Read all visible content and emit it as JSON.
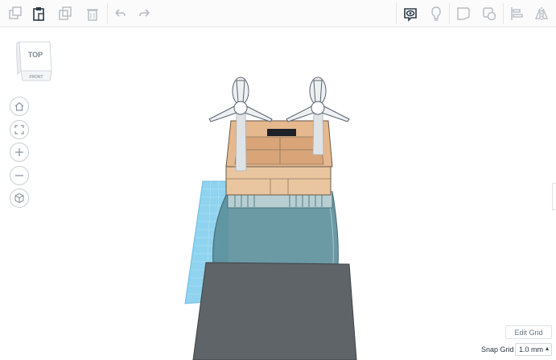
{
  "toolbar": {
    "icons": [
      "copy-icon",
      "paste-icon",
      "duplicate-icon",
      "delete-icon",
      "undo-icon",
      "redo-icon",
      "show-all-icon",
      "note-icon",
      "shape-icon",
      "group-icon",
      "align-icon",
      "mirror-icon"
    ]
  },
  "view_cube": {
    "top_label": "TOP",
    "front_label": "FRONT"
  },
  "view_controls": [
    "home-view",
    "fit-all",
    "zoom-in",
    "zoom-out",
    "perspective-view"
  ],
  "grid": {
    "edit_label": "Edit Grid",
    "snap_label": "Snap Grid",
    "snap_value": "1.0 mm"
  },
  "colors": {
    "blue_plane": "#8fd3ef",
    "box": "#e9c6a0",
    "glass": "#5b8e9a",
    "dark_block": "#5f6468"
  }
}
